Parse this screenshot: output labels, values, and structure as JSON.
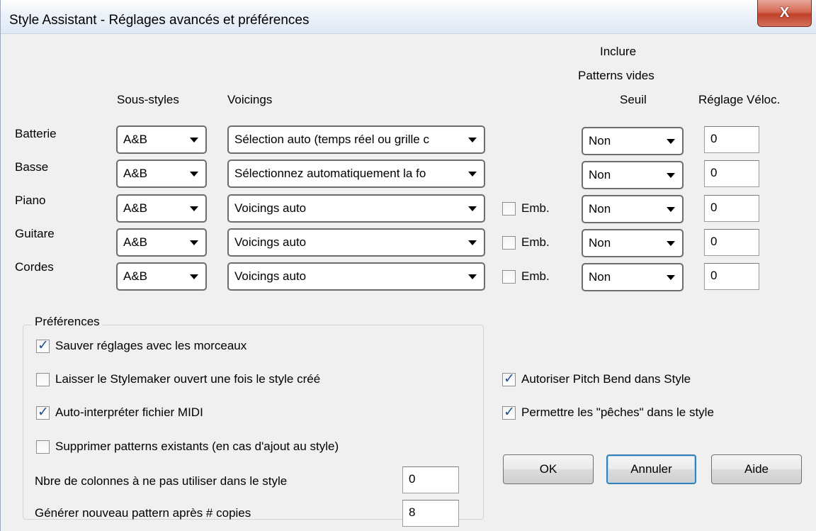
{
  "window": {
    "title": "Style Assistant - Réglages avancés et préférences",
    "close_label": "X"
  },
  "headers": {
    "substyles": "Sous-styles",
    "voicings": "Voicings",
    "include_line1": "Inclure",
    "include_line2": "Patterns vides",
    "include_line3": "Seuil",
    "velocity": "Réglage Véloc."
  },
  "rows": [
    {
      "label": "Batterie",
      "substyle": "A&B",
      "voicing": "Sélection auto (temps réel ou grille c",
      "emb_label": "",
      "emb_checked": false,
      "threshold": "Non",
      "velocity": "0"
    },
    {
      "label": "Basse",
      "substyle": "A&B",
      "voicing": "Sélectionnez automatiquement la fo",
      "emb_label": "",
      "emb_checked": false,
      "threshold": "Non",
      "velocity": "0"
    },
    {
      "label": "Piano",
      "substyle": "A&B",
      "voicing": "Voicings auto",
      "emb_label": "Emb.",
      "emb_checked": false,
      "threshold": "Non",
      "velocity": "0"
    },
    {
      "label": "Guitare",
      "substyle": "A&B",
      "voicing": "Voicings auto",
      "emb_label": "Emb.",
      "emb_checked": false,
      "threshold": "Non",
      "velocity": "0"
    },
    {
      "label": "Cordes",
      "substyle": "A&B",
      "voicing": "Voicings auto",
      "emb_label": "Emb.",
      "emb_checked": false,
      "threshold": "Non",
      "velocity": "0"
    }
  ],
  "preferences": {
    "title": "Préférences",
    "save_settings": {
      "label": "Sauver réglages avec les morceaux",
      "checked": true
    },
    "keep_stylemaker": {
      "label": "Laisser le Stylemaker ouvert une fois le style créé",
      "checked": false
    },
    "auto_interpret": {
      "label": "Auto-interpréter fichier MIDI",
      "checked": true
    },
    "delete_patterns": {
      "label": "Supprimer patterns existants (en cas d'ajout au style)",
      "checked": false
    },
    "columns_label": "Nbre de colonnes à ne pas utiliser dans le style",
    "columns_value": "0",
    "new_pattern_label": "Générer nouveau pattern après # copies",
    "new_pattern_value": "8"
  },
  "options": {
    "pitch_bend": {
      "label": "Autoriser Pitch Bend dans Style",
      "checked": true
    },
    "pushes": {
      "label": "Permettre les \"pêches\" dans le style",
      "checked": true
    }
  },
  "buttons": {
    "ok": "OK",
    "cancel": "Annuler",
    "help": "Aide"
  }
}
